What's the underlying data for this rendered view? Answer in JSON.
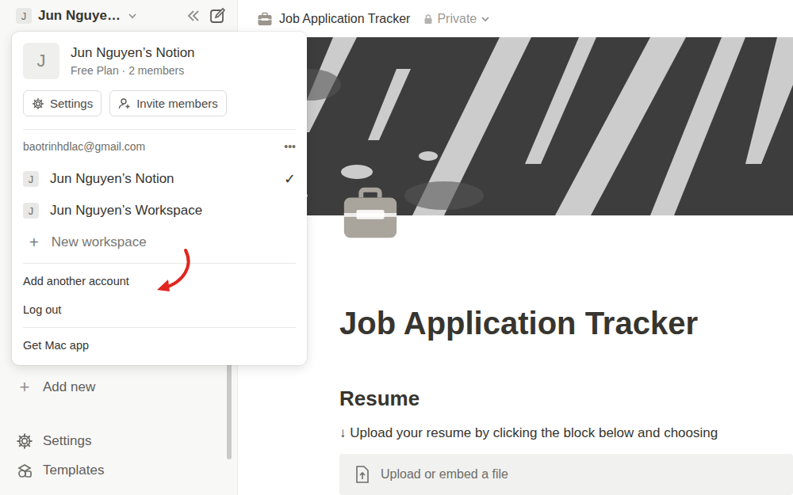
{
  "sidebar": {
    "workspace": {
      "avatar": "J",
      "name": "Jun Nguye…"
    },
    "items": [
      {
        "icon": "+",
        "label": "Add new"
      },
      {
        "label": "Settings"
      },
      {
        "label": "Templates"
      }
    ]
  },
  "topbar": {
    "title": "Job Application Tracker",
    "privacy": "Private"
  },
  "account_menu": {
    "workspace": {
      "avatar": "J",
      "name": "Jun Nguyen’s Notion",
      "plan": "Free Plan · 2 members"
    },
    "buttons": [
      "Settings",
      "Invite members"
    ],
    "email": "baotrinhdlac@gmail.com",
    "more": "•••",
    "check_mark": "✓",
    "workspaces": [
      {
        "avatar": "J",
        "name": "Jun Nguyen’s Notion",
        "selected": true
      },
      {
        "avatar": "J",
        "name": "Jun Nguyen’s Workspace",
        "selected": false
      }
    ],
    "new_workspace": {
      "icon": "+",
      "label": "New workspace"
    },
    "actions": [
      "Add another account",
      "Log out"
    ],
    "footer": "Get Mac app"
  },
  "page": {
    "title": "Job Application Tracker",
    "heading": "Resume",
    "hint": "↓ Upload your resume by clicking the block below and choosing",
    "upload_label": "Upload or embed a file"
  }
}
